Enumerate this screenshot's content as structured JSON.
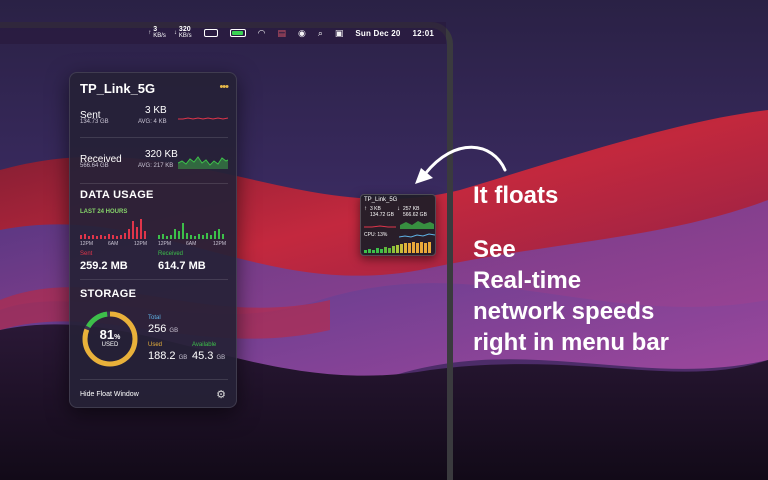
{
  "menubar": {
    "upload_value": "3",
    "upload_unit": "KB/s",
    "download_value": "320",
    "download_unit": "KB/s",
    "date": "Sun Dec 20",
    "time": "12:01"
  },
  "panel": {
    "network_name": "TP_Link_5G",
    "sent": {
      "label": "Sent",
      "value": "3 KB",
      "total": "134.73 GB",
      "avg": "AVG: 4 KB"
    },
    "received": {
      "label": "Received",
      "value": "320 KB",
      "total": "566.64 GB",
      "avg": "AVG: 217 KB"
    },
    "data_usage": {
      "title": "DATA USAGE",
      "range": "LAST 24 HOURS",
      "sent_ticks": [
        "12PM",
        "6AM",
        "12PM"
      ],
      "received_ticks": [
        "12PM",
        "6AM",
        "12PM"
      ],
      "sent_label": "Sent",
      "sent_value": "259.2 MB",
      "received_label": "Received",
      "received_value": "614.7 MB"
    },
    "storage": {
      "title": "STORAGE",
      "percent": "81",
      "percent_unit": "%",
      "used_caption": "USED",
      "total_label": "Total",
      "total_value": "256",
      "total_unit": "GB",
      "used_label": "Used",
      "used_value": "188.2",
      "used_unit": "GB",
      "available_label": "Available",
      "available_value": "45.3",
      "available_unit": "GB",
      "fraction_used": 0.81
    },
    "footer_label": "Hide Float Window"
  },
  "float_window": {
    "network_name": "TP_Link_5G",
    "up_value": "3 KB",
    "up_total": "134.72 GB",
    "down_value": "257 KB",
    "down_total": "566.62 GB",
    "cpu_label": "CPU: 13%"
  },
  "pitch": {
    "line1": "It floats",
    "line2": "See",
    "line3": "Real-time",
    "line4": "network speeds",
    "line5": "right in menu bar"
  },
  "colors": {
    "accent_green": "#3dbf4a",
    "accent_red": "#e0354a",
    "ring_yellow": "#e9b13a",
    "ring_green": "#3dbf4a"
  },
  "icons": [
    "upload-arrow-icon",
    "download-arrow-icon",
    "ssd-icon",
    "battery-icon",
    "wifi-icon",
    "flag-icon",
    "user-icon",
    "search-icon",
    "control-center-icon",
    "more-icon",
    "gear-icon"
  ]
}
